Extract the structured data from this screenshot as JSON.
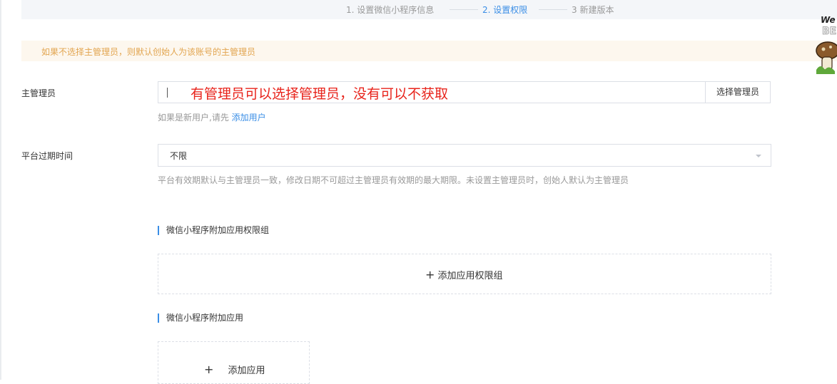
{
  "steps": [
    {
      "label": "1. 设置微信小程序信息",
      "active": false
    },
    {
      "label": "2. 设置权限",
      "active": true
    },
    {
      "label": "3 新建版本",
      "active": false
    }
  ],
  "notice": "如果不选择主管理员，则默认创始人为该账号的主管理员",
  "admin": {
    "label": "主管理员",
    "input_value": "",
    "overlay_annotation": "有管理员可以选择管理员，没有可以不获取",
    "select_button": "选择管理员",
    "hint_prefix": "如果是新用户,请先",
    "hint_link": "添加用户"
  },
  "expiry": {
    "label": "平台过期时间",
    "value": "不限",
    "hint": "平台有效期默认与主管理员一致，修改日期不可超过主管理员有效期的最大期限。未设置主管理员时，创始人默认为主管理员"
  },
  "permission_groups": {
    "title": "微信小程序附加应用权限组",
    "add_label": "添加应用权限组",
    "add_icon": "plus-icon"
  },
  "apps": {
    "title": "微信小程序附加应用",
    "add_label": "添加应用",
    "add_icon": "plus-icon"
  },
  "mascot": {
    "text_top": "We",
    "text_bottom": "BE"
  },
  "colors": {
    "accent": "#3a8ee6",
    "notice_text": "#e2a550",
    "notice_bg": "#fdf7ee",
    "annotation_red": "#e8231b"
  }
}
